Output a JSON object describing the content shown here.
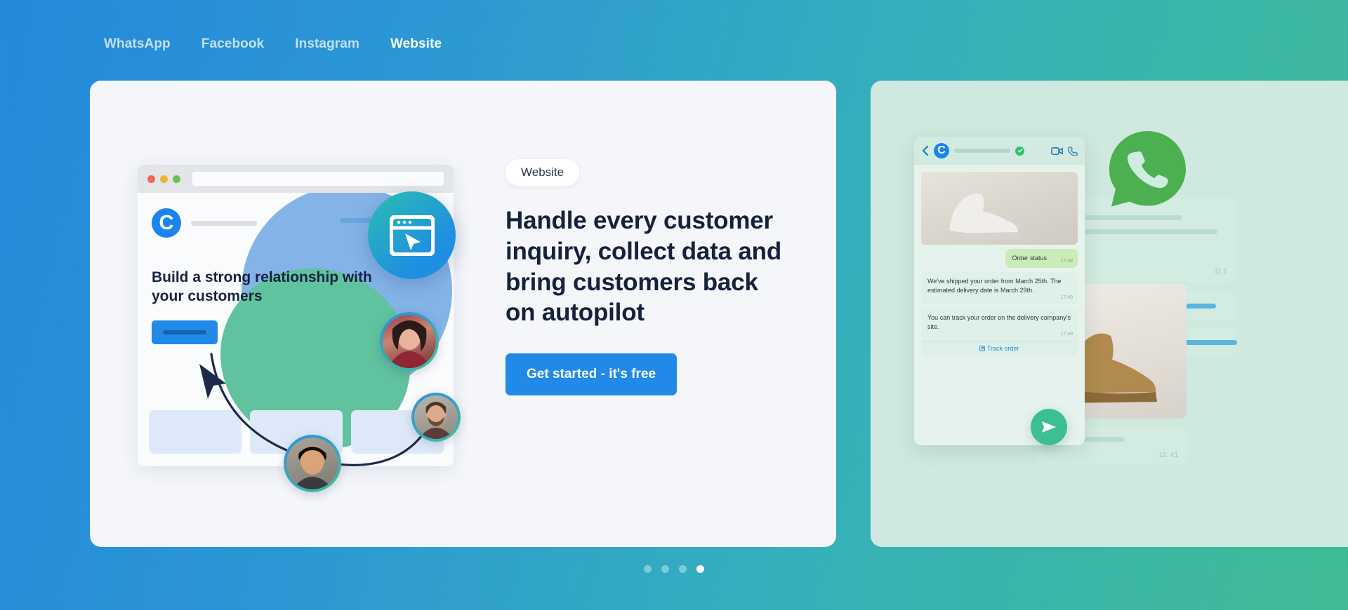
{
  "background": {
    "gradient_from": "#2489dc",
    "gradient_to": "#3fbc94"
  },
  "nav": {
    "tabs": [
      {
        "label": "WhatsApp",
        "active": false
      },
      {
        "label": "Facebook",
        "active": false
      },
      {
        "label": "Instagram",
        "active": false
      },
      {
        "label": "Website",
        "active": true
      }
    ]
  },
  "slide": {
    "badge": "Website",
    "headline": "Handle every customer inquiry, collect data and bring customers back on autopilot",
    "cta_label": "Get started - it's free",
    "cta_color": "#2189e8",
    "illustration": {
      "logo_letter": "C",
      "title": "Build a strong relationship with your customers",
      "icon_name": "website-cursor-icon"
    }
  },
  "next_slide": {
    "channel": "WhatsApp",
    "chat": {
      "messages": [
        {
          "from": "out",
          "text": "Order status",
          "time": "17:48"
        },
        {
          "from": "in",
          "text": "We've shipped your order from March 25th. The estimated delivery date is March 29th.",
          "time": "17:49"
        },
        {
          "from": "in",
          "text": "You can track your order on the delivery company's site.",
          "time": "17:49"
        }
      ],
      "track_link": "Track order"
    },
    "timestamps": {
      "card_top": "11.1",
      "card_bottom": "12. 41"
    }
  },
  "carousel": {
    "total": 4,
    "active_index": 3
  }
}
